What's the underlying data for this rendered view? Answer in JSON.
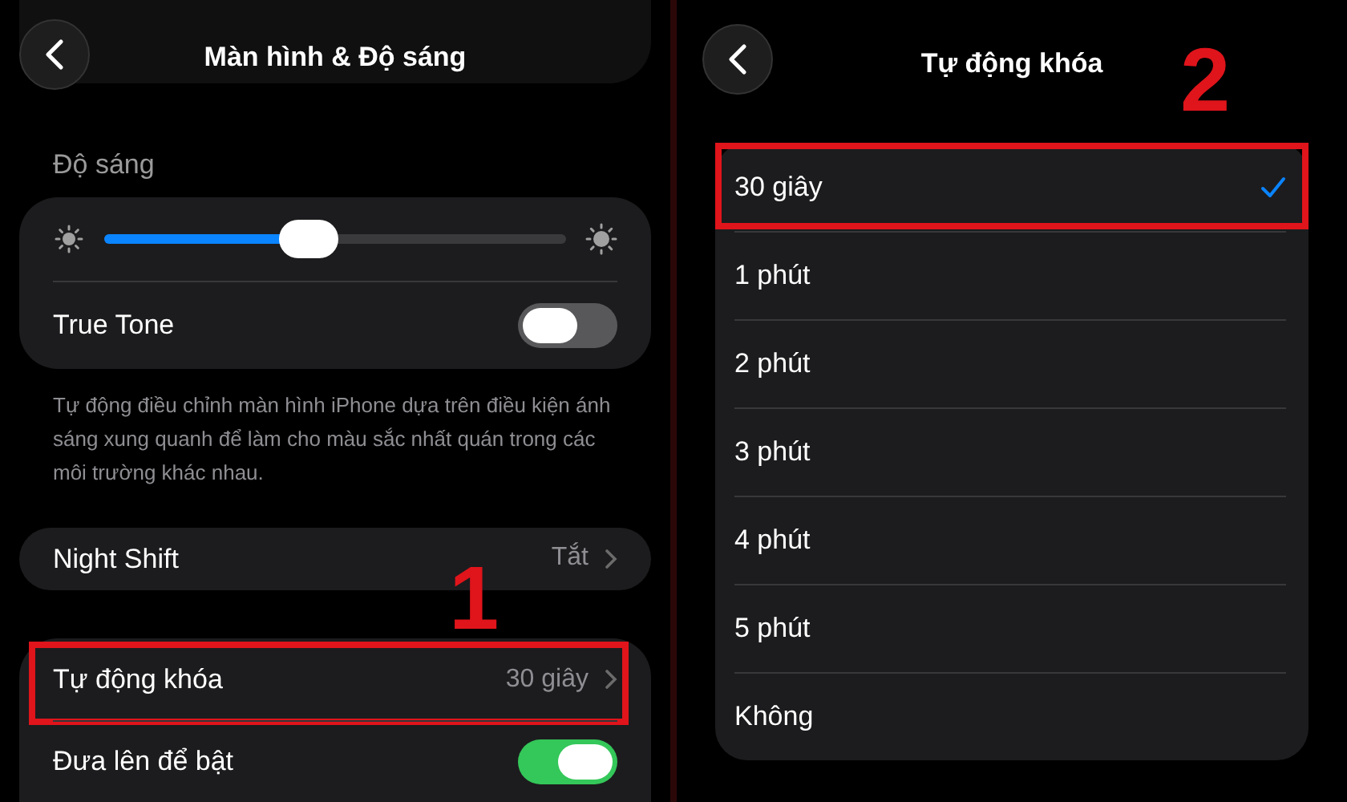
{
  "left_screen": {
    "title": "Màn hình & Độ sáng",
    "brightness": {
      "heading": "Độ sáng",
      "level": 0.44
    },
    "true_tone": {
      "label": "True Tone",
      "on": false
    },
    "caption": "Tự động điều chỉnh màn hình iPhone dựa trên điều kiện ánh sáng xung quanh để làm cho màu sắc nhất quán trong các môi trường khác nhau.",
    "night_shift": {
      "label": "Night Shift",
      "value": "Tắt"
    },
    "lock_group": [
      {
        "kind": "link",
        "label": "Tự động khóa",
        "value": "30 giây",
        "highlighted": true
      },
      {
        "kind": "toggle",
        "label": "Đưa lên để bật",
        "on": true,
        "highlighted": false
      }
    ]
  },
  "right_screen": {
    "title": "Tự động khóa",
    "options": [
      {
        "label": "30 giây",
        "selected": true
      },
      {
        "label": "1 phút",
        "selected": false
      },
      {
        "label": "2 phút",
        "selected": false
      },
      {
        "label": "3 phút",
        "selected": false
      },
      {
        "label": "4 phút",
        "selected": false
      },
      {
        "label": "5 phút",
        "selected": false
      },
      {
        "label": "Không",
        "selected": false
      }
    ]
  },
  "annotations": [
    {
      "label": "1"
    },
    {
      "label": "2"
    }
  ]
}
